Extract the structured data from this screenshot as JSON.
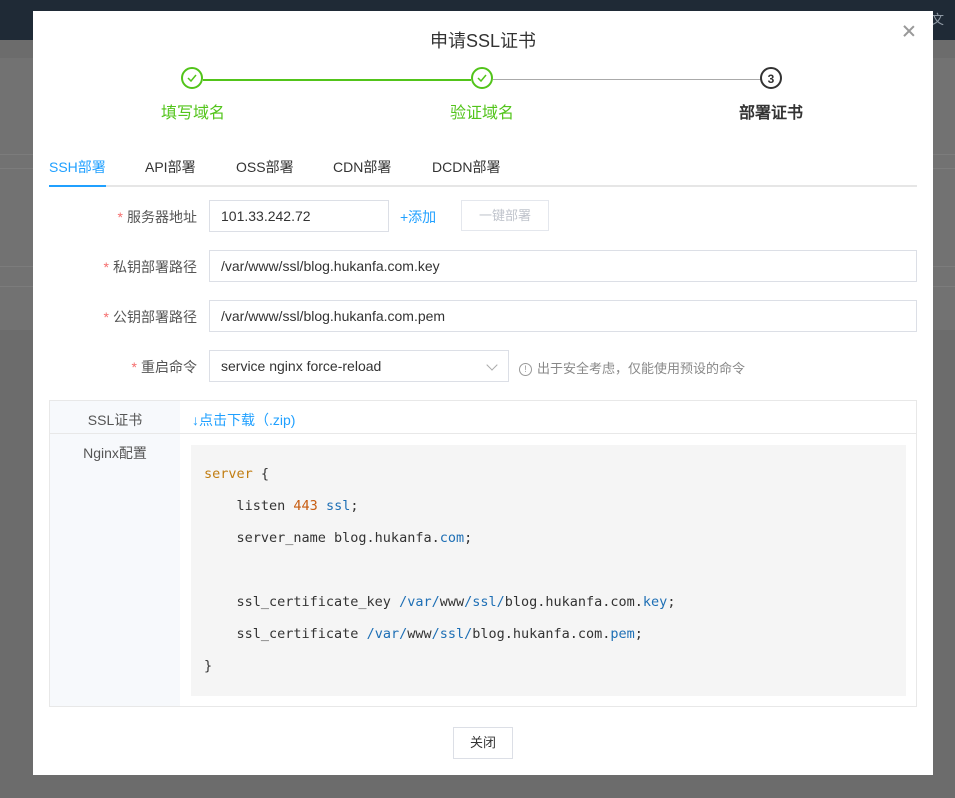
{
  "background": {
    "topbar_links": [
      "使用文"
    ]
  },
  "dialog": {
    "title": "申请SSL证书",
    "steps": [
      {
        "label": "填写域名",
        "status": "done"
      },
      {
        "label": "验证域名",
        "status": "done"
      },
      {
        "label": "部署证书",
        "status": "active",
        "number": "3"
      }
    ],
    "tabs": [
      "SSH部署",
      "API部署",
      "OSS部署",
      "CDN部署",
      "DCDN部署"
    ],
    "active_tab": "SSH部署",
    "form": {
      "server_label": "服务器地址",
      "server_value": "101.33.242.72",
      "add_label": "+添加",
      "deploy_button": "一键部署",
      "private_key_label": "私钥部署路径",
      "private_key_value": "/var/www/ssl/blog.hukanfa.com.key",
      "public_key_label": "公钥部署路径",
      "public_key_value": "/var/www/ssl/blog.hukanfa.com.pem",
      "restart_label": "重启命令",
      "restart_value": "service nginx force-reload",
      "restart_hint": "出于安全考虑，仅能使用预设的命令",
      "required_mark": "*"
    },
    "info": {
      "ssl_label": "SSL证书",
      "download_link": "↓点击下载（.zip)",
      "nginx_label": "Nginx配置"
    },
    "close_button": "关闭"
  },
  "colors": {
    "accent": "#20a0ff",
    "success": "#52c41a",
    "required": "#f56c6c"
  }
}
